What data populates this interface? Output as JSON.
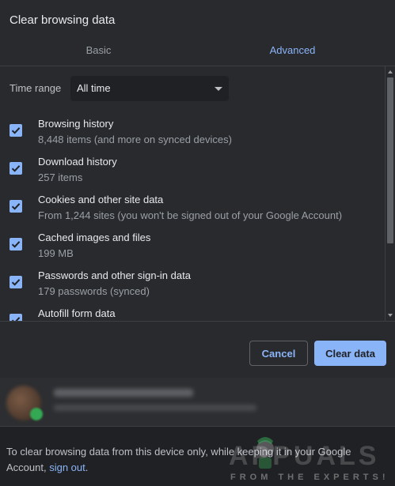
{
  "dialog": {
    "title": "Clear browsing data",
    "tabs": [
      {
        "label": "Basic",
        "selected": false
      },
      {
        "label": "Advanced",
        "selected": true
      }
    ],
    "time_range": {
      "label": "Time range",
      "value": "All time"
    },
    "items": [
      {
        "title": "Browsing history",
        "description": "8,448 items (and more on synced devices)",
        "checked": true
      },
      {
        "title": "Download history",
        "description": "257 items",
        "checked": true
      },
      {
        "title": "Cookies and other site data",
        "description": "From 1,244 sites (you won't be signed out of your Google Account)",
        "checked": true
      },
      {
        "title": "Cached images and files",
        "description": "199 MB",
        "checked": true
      },
      {
        "title": "Passwords and other sign-in data",
        "description": "179 passwords (synced)",
        "checked": true
      },
      {
        "title": "Autofill form data",
        "description": "",
        "checked": true
      }
    ],
    "buttons": {
      "cancel": "Cancel",
      "clear": "Clear data"
    }
  },
  "footer_info": {
    "text_before": "To clear browsing data from this device only, while keeping it in your Google Account, ",
    "link": "sign out",
    "text_after": "."
  },
  "watermark": {
    "brand": "APPUALS",
    "tagline": "FROM THE EXPERTS!"
  },
  "colors": {
    "accent": "#8ab4f8",
    "background": "#292a2d",
    "page_background": "#202124"
  }
}
